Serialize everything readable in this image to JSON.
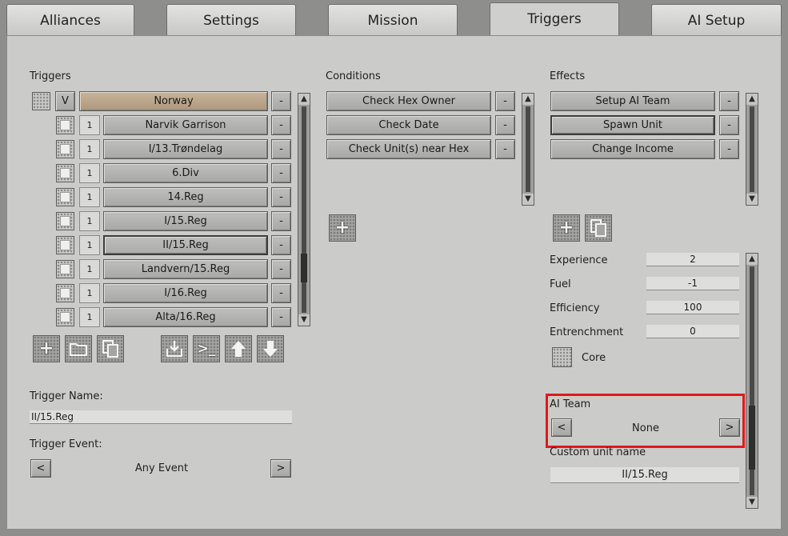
{
  "tabs": [
    {
      "label": "Alliances"
    },
    {
      "label": "Settings"
    },
    {
      "label": "Mission"
    },
    {
      "label": "Triggers",
      "active": true
    },
    {
      "label": "AI Setup"
    }
  ],
  "triggers": {
    "heading": "Triggers",
    "root": {
      "toggle": "V",
      "label": "Norway"
    },
    "items": [
      {
        "num": "1",
        "label": "Narvik Garrison"
      },
      {
        "num": "1",
        "label": "I/13.Trøndelag"
      },
      {
        "num": "1",
        "label": "6.Div"
      },
      {
        "num": "1",
        "label": "14.Reg"
      },
      {
        "num": "1",
        "label": "I/15.Reg"
      },
      {
        "num": "1",
        "label": "II/15.Reg",
        "selected": true
      },
      {
        "num": "1",
        "label": "Landvern/15.Reg"
      },
      {
        "num": "1",
        "label": "I/16.Reg"
      },
      {
        "num": "1",
        "label": "Alta/16.Reg"
      }
    ],
    "minus": "-"
  },
  "conditions": {
    "heading": "Conditions",
    "items": [
      {
        "label": "Check Hex Owner"
      },
      {
        "label": "Check Date"
      },
      {
        "label": "Check Unit(s) near Hex"
      }
    ]
  },
  "effects": {
    "heading": "Effects",
    "items": [
      {
        "label": "Setup AI Team"
      },
      {
        "label": "Spawn Unit",
        "selected": true
      },
      {
        "label": "Change Income"
      }
    ]
  },
  "properties": {
    "experience": {
      "label": "Experience",
      "value": "2"
    },
    "fuel": {
      "label": "Fuel",
      "value": "-1"
    },
    "efficiency": {
      "label": "Efficiency",
      "value": "100"
    },
    "entrenchment": {
      "label": "Entrenchment",
      "value": "0"
    },
    "core": {
      "label": "Core"
    },
    "ai_team": {
      "label": "AI Team",
      "value": "None",
      "prev": "<",
      "next": ">"
    },
    "custom_unit_name": {
      "label": "Custom unit name",
      "value": "II/15.Reg"
    }
  },
  "trigger_name": {
    "label": "Trigger Name:",
    "value": "II/15.Reg"
  },
  "trigger_event": {
    "label": "Trigger Event:",
    "value": "Any Event",
    "prev": "<",
    "next": ">"
  },
  "icons": {
    "add": "+",
    "folder": "folder-icon",
    "copy": "copy-icon",
    "import": "import-icon",
    "console": ">_",
    "up": "arrow-up-icon",
    "down": "arrow-down-icon"
  },
  "colors": {
    "highlight": "#e0191b",
    "selected_row": "#c4ad90"
  }
}
